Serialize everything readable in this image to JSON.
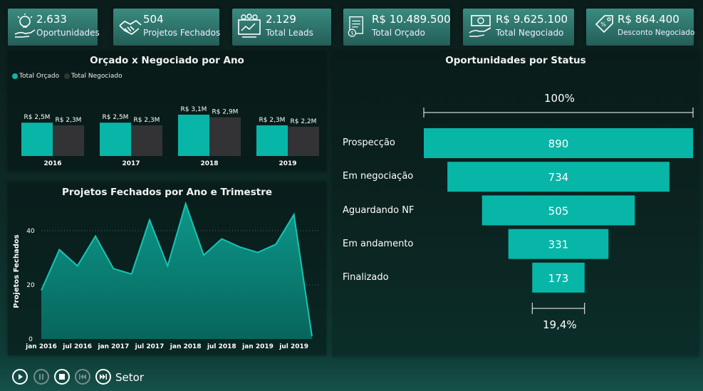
{
  "kpis": [
    {
      "value": "2.633",
      "label": "Oportunidades",
      "icon": "lightbulb-hand-icon"
    },
    {
      "value": "504",
      "label": "Projetos Fechados",
      "icon": "handshake-icon"
    },
    {
      "value": "2.129",
      "label": "Total Leads",
      "icon": "leads-board-icon"
    },
    {
      "value": "R$ 10.489.500",
      "label": "Total Orçado",
      "icon": "budget-document-icon"
    },
    {
      "value": "R$ 9.625.100",
      "label": "Total Negociado",
      "icon": "money-hand-icon"
    },
    {
      "value": "R$ 864.400",
      "label": "Desconto Negociado",
      "icon": "discount-tag-icon"
    }
  ],
  "bar_chart": {
    "title": "Orçado x Negociado por Ano",
    "legend": [
      "Total Orçado",
      "Total Negociado"
    ]
  },
  "line_chart": {
    "title": "Projetos Fechados por Ano e Trimestre",
    "ylabel": "Projetos Fechados"
  },
  "funnel": {
    "title": "Oportunidades por Status",
    "top_pct": "100%",
    "bottom_pct": "19,4%",
    "stages": [
      {
        "label": "Prospecção",
        "value": "890"
      },
      {
        "label": "Em negociação",
        "value": "734"
      },
      {
        "label": "Aguardando NF",
        "value": "505"
      },
      {
        "label": "Em andamento",
        "value": "331"
      },
      {
        "label": "Finalizado",
        "value": "173"
      }
    ]
  },
  "player": {
    "label": "Setor"
  },
  "colors": {
    "teal": "#08b6a8",
    "dark": "#333335",
    "line": "#17c4b3",
    "area": "#0a8d80"
  },
  "chart_data": [
    {
      "type": "bar",
      "title": "Orçado x Negociado por Ano",
      "categories": [
        "2016",
        "2017",
        "2018",
        "2019"
      ],
      "series": [
        {
          "name": "Total Orçado",
          "values": [
            2.5,
            2.5,
            3.1,
            2.3
          ],
          "labels": [
            "R$ 2,5M",
            "R$ 2,5M",
            "R$ 3,1M",
            "R$ 2,3M"
          ]
        },
        {
          "name": "Total Negociado",
          "values": [
            2.3,
            2.3,
            2.9,
            2.2
          ],
          "labels": [
            "R$ 2,3M",
            "R$ 2,3M",
            "R$ 2,9M",
            "R$ 2,2M"
          ]
        }
      ]
    },
    {
      "type": "area",
      "title": "Projetos Fechados por Ano e Trimestre",
      "ylabel": "Projetos Fechados",
      "ylim": [
        0,
        50
      ],
      "yticks": [
        "0",
        "20",
        "40"
      ],
      "xticks": [
        "jan 2016",
        "jul 2016",
        "jan 2017",
        "jul 2017",
        "jan 2018",
        "jul 2018",
        "jan 2019",
        "jul 2019"
      ],
      "values": [
        18,
        33,
        27,
        38,
        26,
        24,
        44,
        27,
        50,
        31,
        37,
        34,
        32,
        35,
        46,
        1
      ]
    },
    {
      "type": "funnel",
      "title": "Oportunidades por Status",
      "categories": [
        "Prospecção",
        "Em negociação",
        "Aguardando NF",
        "Em andamento",
        "Finalizado"
      ],
      "values": [
        890,
        734,
        505,
        331,
        173
      ]
    }
  ]
}
